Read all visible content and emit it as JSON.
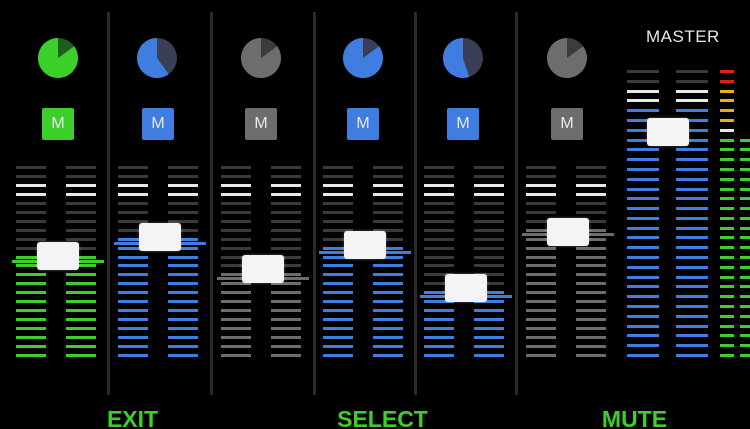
{
  "colors": {
    "green": "#3ccf2a",
    "blue": "#3f7de0",
    "gray": "#6d6d6d",
    "knob_background": "#3a3f55",
    "meter_unlit": "#3a3a3a",
    "meter_top": "#e8e8e8",
    "softkey_text": "#3ccf2a"
  },
  "channels": [
    {
      "id": "ch1",
      "color": "green",
      "pan_fill": 0.85,
      "mute_label": "M",
      "fader_level": 0.52,
      "meter_level": 0.52
    },
    {
      "id": "ch2",
      "color": "blue",
      "pan_fill": 0.6,
      "mute_label": "M",
      "fader_level": 0.62,
      "meter_level": 0.62
    },
    {
      "id": "ch3",
      "color": "gray",
      "pan_fill": 0.85,
      "mute_label": "M",
      "fader_level": 0.45,
      "meter_level": 0.45
    },
    {
      "id": "ch4",
      "color": "blue",
      "pan_fill": 0.85,
      "mute_label": "M",
      "fader_level": 0.58,
      "meter_level": 0.58
    },
    {
      "id": "ch5",
      "color": "blue",
      "pan_fill": 0.55,
      "mute_label": "M",
      "fader_level": 0.35,
      "meter_level": 0.35
    },
    {
      "id": "ch6",
      "color": "gray",
      "pan_fill": 0.85,
      "mute_label": "M",
      "fader_level": 0.65,
      "meter_level": 0.65
    }
  ],
  "master": {
    "label": "MASTER",
    "fader_level": 0.78,
    "meter_level": 0.85
  },
  "softkeys": [
    {
      "id": "exit",
      "label": "EXIT"
    },
    {
      "id": "select",
      "label": "SELECT"
    },
    {
      "id": "mute",
      "label": "MUTE"
    }
  ]
}
